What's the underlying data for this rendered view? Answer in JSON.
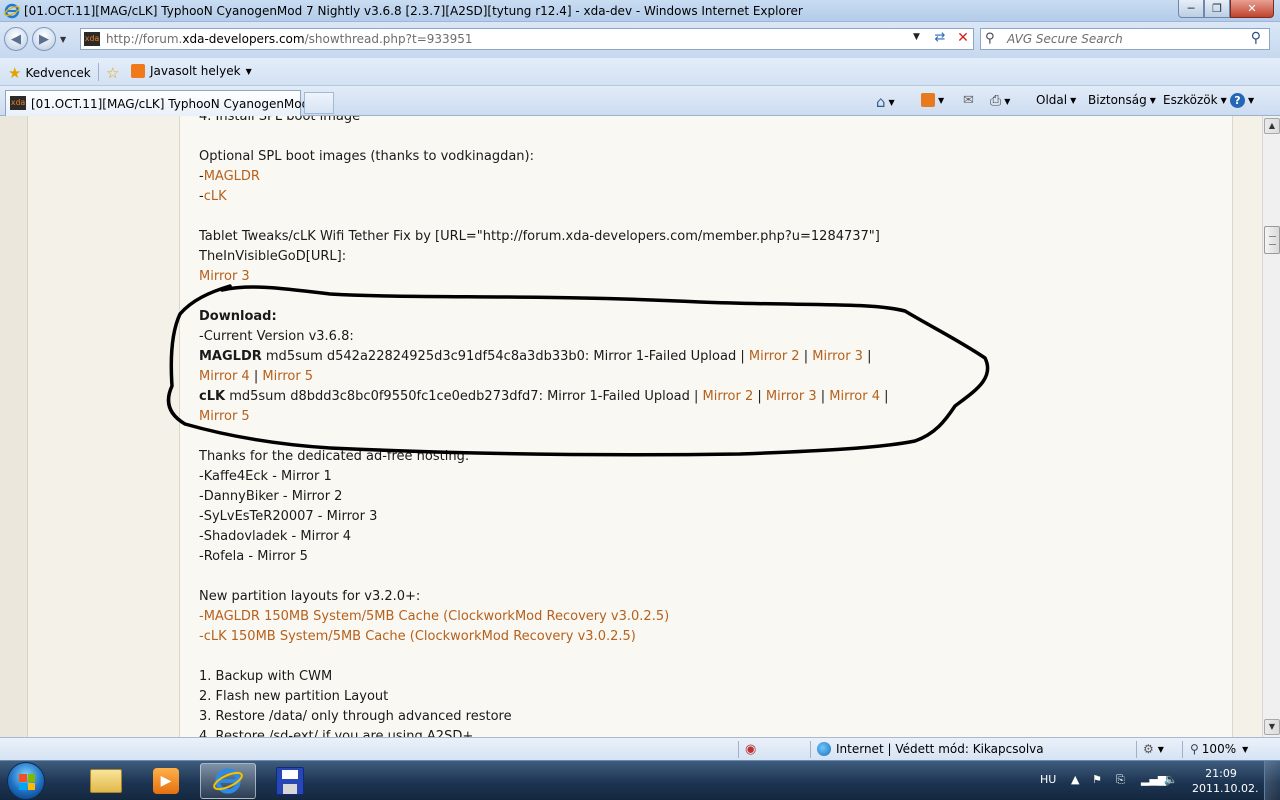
{
  "window": {
    "title": "[01.OCT.11][MAG/cLK] TyphooN CyanogenMod 7 Nightly v3.6.8 [2.3.7][A2SD][tytung r12.4] - xda-dev - Windows Internet Explorer",
    "min_icon": "minimize-icon",
    "max_icon": "maximize-icon",
    "close_icon": "close-icon"
  },
  "address": {
    "url_prefix": "http://forum.",
    "url_domain": "xda-developers.com",
    "url_path": "/showthread.php?t=933951",
    "favicon": "xda"
  },
  "search": {
    "placeholder": "AVG Secure Search"
  },
  "favorites": {
    "favorites_label": "Kedvencek",
    "suggested_label": "Javasolt helyek"
  },
  "tab": {
    "label": "[01.OCT.11][MAG/cLK] TyphooN CyanogenMod ..."
  },
  "commandbar": {
    "page": "Oldal",
    "safety": "Biztonság",
    "tools": "Eszközök"
  },
  "post": {
    "l00": "4. Install SPL boot image",
    "l01": "Optional SPL boot images (thanks to vodkinagdan):",
    "l02_link": "MAGLDR",
    "l03_link": "cLK",
    "l04": "Tablet Tweaks/cLK Wifi Tether Fix by [URL=\"http://forum.xda-developers.com/member.php?u=1284737\"]",
    "l05": "TheInVisibleGoD[URL]:",
    "l06_link": "Mirror 3",
    "download_heading": "Download:",
    "current_version": "-Current Version v3.6.8:",
    "magldr_bold": "MAGLDR",
    "magldr_md5": " md5sum d542a22824925d3c91df54c8a3db33b0: Mirror 1-Failed Upload | ",
    "magldr_m2": "Mirror 2",
    "magldr_m3": "Mirror 3",
    "magldr_m4": "Mirror 4",
    "magldr_m5": "Mirror 5",
    "clk_bold": "cLK",
    "clk_md5": " md5sum d8bdd3c8bc0f9550fc1ce0edb273dfd7: Mirror 1-Failed Upload | ",
    "clk_m2": "Mirror 2",
    "clk_m3": "Mirror 3",
    "clk_m4": "Mirror 4",
    "clk_m5": "Mirror 5",
    "thanks": "Thanks for the dedicated ad-free hosting:",
    "host1": "-Kaffe4Eck - Mirror 1",
    "host2": "-DannyBiker - Mirror 2",
    "host3": "-SyLvEsTeR20007 - Mirror 3",
    "host4": "-Shadovladek - Mirror 4",
    "host5": "-Rofela - Mirror 5",
    "partition": "New partition layouts for v3.2.0+:",
    "part_magldr": "MAGLDR 150MB System/5MB Cache (ClockworkMod Recovery v3.0.2.5)",
    "part_clk": "cLK 150MB System/5MB Cache (ClockworkMod Recovery v3.0.2.5)",
    "step1": "1. Backup with CWM",
    "step2": "2. Flash new partition Layout",
    "step3": "3. Restore /data/ only through advanced restore",
    "step4": "4. Restore /sd-ext/ if you are using A2SD+"
  },
  "statusbar": {
    "zone": "Internet | Védett mód: Kikapcsolva",
    "zoom": "100%"
  },
  "taskbar": {
    "lang": "HU",
    "time": "21:09",
    "date": "2011.10.02."
  },
  "colors": {
    "link": "#b5611d",
    "scribble": "#000000"
  }
}
